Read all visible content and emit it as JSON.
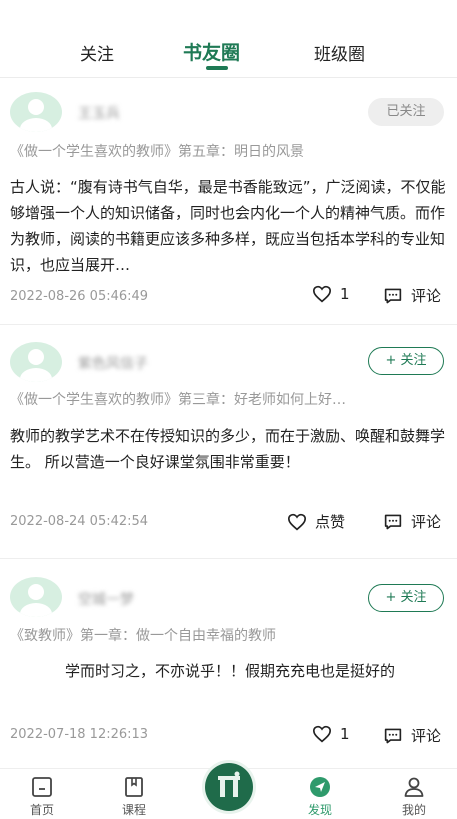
{
  "tabs": [
    {
      "label": "关注"
    },
    {
      "label": "书友圈"
    },
    {
      "label": "班级圈"
    }
  ],
  "posts": [
    {
      "username": "王玉兵",
      "follow": "已关注",
      "book": "《做一个学生喜欢的教师》第五章：明日的风景",
      "content": "古人说：“腹有诗书气自华，最是书香能致远”，广泛阅读，不仅能够增强一个人的知识储备，同时也会内化一个人的精神气质。而作为教师，阅读的书籍更应该多种多样，既应当包括本学科的专业知识，也应当展开…",
      "time": "2022-08-26 05:46:49",
      "likes": "1",
      "comment": "评论"
    },
    {
      "username": "紫色风信子",
      "follow": "+ 关注",
      "book": "《做一个学生喜欢的教师》第三章：好老师如何上好…",
      "content": "教师的教学艺术不在传授知识的多少，而在于激励、唤醒和鼓舞学生。 所以营造一个良好课堂氛围非常重要！",
      "time": "2022-08-24 05:42:54",
      "likes": "点赞",
      "comment": "评论"
    },
    {
      "username": "空城一梦",
      "follow": "+ 关注",
      "book": "《致教师》第一章：做一个自由幸福的教师",
      "content": "学而时习之，不亦说乎！！假期充充电也是挺好的",
      "time": "2022-07-18 12:26:13",
      "likes": "1",
      "comment": "评论"
    }
  ],
  "nav": [
    {
      "label": "首页",
      "icon": "home-icon"
    },
    {
      "label": "课程",
      "icon": "book-icon"
    },
    {
      "label": "",
      "icon": "center-logo-icon"
    },
    {
      "label": "发现",
      "icon": "discover-icon"
    },
    {
      "label": "我的",
      "icon": "profile-icon"
    }
  ],
  "colors": {
    "accent": "#1f7a55",
    "nav_active": "#2e9a6b"
  }
}
